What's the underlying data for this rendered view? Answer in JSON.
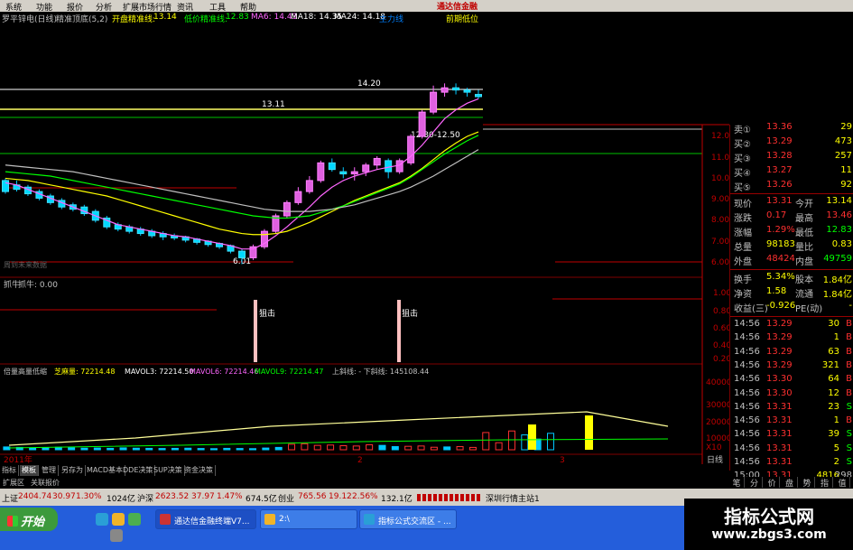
{
  "menu": {
    "items": [
      "系统",
      "功能",
      "报价",
      "分析",
      "扩展市场行情",
      "资讯",
      "工具",
      "帮助"
    ],
    "brand": "通达信金融"
  },
  "info": {
    "title": "罗平锌电(日线)",
    "indicator": "精准顶底(5,2)",
    "open_line_label": "开盘精准线:",
    "open_line_value": "13.14",
    "low_line_label": "低价精准线:",
    "low_line_value": "12.83",
    "ma6": "MA6: 14.43",
    "ma18": "MA18: 14.35",
    "ma24": "MA24: 14.18",
    "tail1": "主力线",
    "tail2": "前期低位"
  },
  "chart": {
    "price_ticks": [
      "12.00",
      "11.00",
      "10.00",
      "9.00",
      "8.00",
      "7.00",
      "6.00"
    ],
    "labels": {
      "high_level": "14.20",
      "mid_level": "13.11",
      "range": "12.30-12.50",
      "low_point": "6.01",
      "dim_note": "周到未来数据"
    },
    "sub1": {
      "title": "抓牛",
      "value": "抓牛: 0.00",
      "ticks": [
        "1.00",
        "0.80",
        "0.60",
        "0.40",
        "0.20"
      ],
      "signal": "狙击"
    },
    "sub2": {
      "title": "倍量高量低缩",
      "vol": "芝麻量: 72214.48",
      "mavol3": "MAVOL3: 72214.50",
      "mavol6": "MAVOL6: 72214.46",
      "mavol9": "MAVOL9: 72214.47",
      "trend": "上斜线: - 下斜线: 145108.44",
      "ticks": [
        "40000",
        "30000",
        "20000",
        "10000"
      ],
      "unit": "X10"
    },
    "x_labels": [
      "2011年",
      "2",
      "3"
    ],
    "period": "日线"
  },
  "quote": {
    "asks": [
      {
        "label": "卖①",
        "price": "13.36",
        "vol": "29"
      },
      {
        "label": "买②",
        "price": "13.29",
        "vol": "473"
      },
      {
        "label": "买③",
        "price": "13.28",
        "vol": "257"
      },
      {
        "label": "买④",
        "price": "13.27",
        "vol": "11"
      },
      {
        "label": "买⑤",
        "price": "13.26",
        "vol": "92"
      }
    ],
    "stats": [
      {
        "k1": "现价",
        "v1": "13.31",
        "k2": "今开",
        "v2": "13.14"
      },
      {
        "k1": "涨跌",
        "v1": "0.17",
        "k2": "最高",
        "v2": "13.46"
      },
      {
        "k1": "涨幅",
        "v1": "1.29%",
        "k2": "最低",
        "v2": "12.83"
      },
      {
        "k1": "总量",
        "v1": "98183",
        "k2": "量比",
        "v2": "0.83"
      },
      {
        "k1": "外盘",
        "v1": "48424",
        "k2": "内盘",
        "v2": "49759"
      }
    ],
    "stats2": [
      {
        "k1": "换手",
        "v1": "5.34%",
        "k2": "股本",
        "v2": "1.84亿"
      },
      {
        "k1": "净资",
        "v1": "1.58",
        "k2": "流通",
        "v2": "1.84亿"
      },
      {
        "k1": "收益(三)",
        "v1": "-0.926",
        "k2": "PE(动)",
        "v2": "-"
      }
    ],
    "ticks": [
      {
        "time": "14:56",
        "price": "13.29",
        "vol": "30",
        "side": "B"
      },
      {
        "time": "14:56",
        "price": "13.29",
        "vol": "1",
        "side": "B"
      },
      {
        "time": "14:56",
        "price": "13.29",
        "vol": "63",
        "side": "B"
      },
      {
        "time": "14:56",
        "price": "13.29",
        "vol": "321",
        "side": "B"
      },
      {
        "time": "14:56",
        "price": "13.30",
        "vol": "64",
        "side": "B"
      },
      {
        "time": "14:56",
        "price": "13.30",
        "vol": "12",
        "side": "B"
      },
      {
        "time": "14:56",
        "price": "13.31",
        "vol": "23",
        "side": "S"
      },
      {
        "time": "14:56",
        "price": "13.31",
        "vol": "1",
        "side": "B"
      },
      {
        "time": "14:56",
        "price": "13.31",
        "vol": "39",
        "side": "S"
      },
      {
        "time": "14:56",
        "price": "13.31",
        "vol": "5",
        "side": "S"
      },
      {
        "time": "14:56",
        "price": "13.31",
        "vol": "2",
        "side": "S"
      },
      {
        "time": "15:00",
        "price": "13.31",
        "vol": "4816",
        "side": "298"
      }
    ],
    "bottom_tabs": [
      "笔",
      "分",
      "价",
      "盘",
      "势",
      "指",
      "值"
    ]
  },
  "tabs": {
    "items": [
      "指标",
      "模板",
      "管理",
      "另存为",
      "MACD基本",
      "DDE决策",
      "SUP决策",
      "资金决策"
    ],
    "active_index": 1,
    "sub_items": [
      "扩展区",
      "关联报价"
    ]
  },
  "status": {
    "sh_label": "上证",
    "sh_value": "2404.74",
    "sh_change": "30.97",
    "sh_pct": "1.30%",
    "sh_amount": "1024亿",
    "sz_label": "沪深",
    "sz_value": "2623.52",
    "sz_change": "37.97",
    "sz_pct": "1.47%",
    "sz_amount": "674.5亿",
    "cy_label": "创业",
    "cy_value": "765.56",
    "cy_change": "19.12",
    "cy_pct": "2.56%",
    "cy_amount": "132.1亿",
    "server": "深圳行情主站1"
  },
  "taskbar": {
    "start": "开始",
    "tasks": [
      "通达信金融终端V7...",
      "2:\\",
      "指标公式交流区 - ..."
    ]
  },
  "watermark": {
    "title": "指标公式网",
    "url": "www.zbgs3.com"
  },
  "chart_data": {
    "type": "candlestick",
    "title": "罗平锌电(日线)",
    "candles": [
      {
        "o": 9.8,
        "c": 9.3,
        "h": 9.9,
        "l": 9.2
      },
      {
        "o": 9.6,
        "c": 9.4,
        "h": 9.8,
        "l": 9.3
      },
      {
        "o": 9.5,
        "c": 9.2,
        "h": 9.6,
        "l": 9.1
      },
      {
        "o": 9.3,
        "c": 9.0,
        "h": 9.4,
        "l": 8.9
      },
      {
        "o": 9.1,
        "c": 8.8,
        "h": 9.2,
        "l": 8.7
      },
      {
        "o": 8.9,
        "c": 8.6,
        "h": 9.0,
        "l": 8.5
      },
      {
        "o": 8.7,
        "c": 8.5,
        "h": 8.8,
        "l": 8.4
      },
      {
        "o": 8.6,
        "c": 8.3,
        "h": 8.7,
        "l": 8.2
      },
      {
        "o": 8.4,
        "c": 8.0,
        "h": 8.5,
        "l": 7.9
      },
      {
        "o": 8.1,
        "c": 7.7,
        "h": 8.2,
        "l": 7.6
      },
      {
        "o": 7.8,
        "c": 7.6,
        "h": 7.9,
        "l": 7.5
      },
      {
        "o": 7.7,
        "c": 7.5,
        "h": 7.8,
        "l": 7.4
      },
      {
        "o": 7.6,
        "c": 7.4,
        "h": 7.7,
        "l": 7.3
      },
      {
        "o": 7.5,
        "c": 7.3,
        "h": 7.6,
        "l": 7.2
      },
      {
        "o": 7.4,
        "c": 7.25,
        "h": 7.5,
        "l": 7.1
      },
      {
        "o": 7.3,
        "c": 7.2,
        "h": 7.4,
        "l": 7.1
      },
      {
        "o": 7.25,
        "c": 7.1,
        "h": 7.3,
        "l": 7.0
      },
      {
        "o": 7.15,
        "c": 7.0,
        "h": 7.2,
        "l": 6.9
      },
      {
        "o": 7.05,
        "c": 6.9,
        "h": 7.1,
        "l": 6.8
      },
      {
        "o": 6.95,
        "c": 6.8,
        "h": 7.0,
        "l": 6.7
      },
      {
        "o": 6.85,
        "c": 6.6,
        "h": 6.9,
        "l": 6.5
      },
      {
        "o": 6.6,
        "c": 6.3,
        "h": 6.7,
        "l": 6.01
      },
      {
        "o": 6.3,
        "c": 6.8,
        "h": 6.9,
        "l": 6.2
      },
      {
        "o": 6.8,
        "c": 7.5,
        "h": 7.6,
        "l": 6.7
      },
      {
        "o": 7.5,
        "c": 8.2,
        "h": 8.3,
        "l": 7.4
      },
      {
        "o": 8.2,
        "c": 8.8,
        "h": 8.9,
        "l": 8.1
      },
      {
        "o": 8.8,
        "c": 9.3,
        "h": 9.5,
        "l": 8.7
      },
      {
        "o": 9.3,
        "c": 9.8,
        "h": 10.0,
        "l": 9.2
      },
      {
        "o": 9.8,
        "c": 10.6,
        "h": 10.7,
        "l": 9.7
      },
      {
        "o": 10.6,
        "c": 10.3,
        "h": 10.8,
        "l": 10.2
      },
      {
        "o": 10.2,
        "c": 10.1,
        "h": 10.4,
        "l": 9.9
      },
      {
        "o": 10.1,
        "c": 10.2,
        "h": 10.4,
        "l": 9.8
      },
      {
        "o": 10.2,
        "c": 10.5,
        "h": 10.6,
        "l": 10.0
      },
      {
        "o": 10.5,
        "c": 10.8,
        "h": 10.9,
        "l": 10.3
      },
      {
        "o": 10.7,
        "c": 10.2,
        "h": 10.8,
        "l": 9.9
      },
      {
        "o": 10.2,
        "c": 10.7,
        "h": 10.8,
        "l": 10.1
      },
      {
        "o": 10.6,
        "c": 11.8,
        "h": 11.9,
        "l": 10.5
      },
      {
        "o": 11.8,
        "c": 12.9,
        "h": 13.0,
        "l": 11.7
      },
      {
        "o": 12.9,
        "c": 13.8,
        "h": 14.1,
        "l": 12.8
      },
      {
        "o": 13.8,
        "c": 14.0,
        "h": 14.2,
        "l": 13.6
      },
      {
        "o": 14.0,
        "c": 13.9,
        "h": 14.2,
        "l": 13.7
      },
      {
        "o": 13.9,
        "c": 13.8,
        "h": 14.0,
        "l": 13.6
      },
      {
        "o": 13.7,
        "c": 13.6,
        "h": 13.9,
        "l": 13.5
      }
    ],
    "ma_series": [
      {
        "color": "#ffffff",
        "values": [
          9.7,
          9.6,
          9.4,
          9.2,
          9.0,
          8.8,
          8.6,
          8.4,
          8.2,
          8.0,
          7.8,
          7.7,
          7.6,
          7.5,
          7.4,
          7.3,
          7.25,
          7.15,
          7.05,
          6.95,
          6.85,
          6.7,
          6.7,
          6.95,
          7.3,
          7.7,
          8.15,
          8.6,
          9.1,
          9.5,
          9.8,
          10.0,
          10.15,
          10.3,
          10.4,
          10.5,
          10.9,
          11.4,
          12.0,
          12.6,
          13.0,
          13.3,
          13.5
        ]
      },
      {
        "color": "#ffff00",
        "values": [
          9.9,
          9.85,
          9.8,
          9.7,
          9.6,
          9.5,
          9.4,
          9.3,
          9.2,
          9.1,
          8.95,
          8.8,
          8.65,
          8.5,
          8.35,
          8.2,
          8.05,
          7.9,
          7.75,
          7.6,
          7.5,
          7.4,
          7.35,
          7.35,
          7.4,
          7.5,
          7.7,
          7.9,
          8.15,
          8.4,
          8.65,
          8.9,
          9.1,
          9.3,
          9.5,
          9.7,
          10.0,
          10.35,
          10.75,
          11.15,
          11.5,
          11.8,
          12.0
        ]
      },
      {
        "color": "#00ff00",
        "values": [
          10.2,
          10.15,
          10.1,
          10.05,
          10.0,
          9.9,
          9.8,
          9.7,
          9.6,
          9.5,
          9.4,
          9.3,
          9.2,
          9.1,
          9.0,
          8.9,
          8.8,
          8.7,
          8.6,
          8.5,
          8.4,
          8.3,
          8.2,
          8.15,
          8.1,
          8.1,
          8.15,
          8.2,
          8.35,
          8.5,
          8.65,
          8.85,
          9.05,
          9.25,
          9.45,
          9.65,
          9.95,
          10.3,
          10.65,
          11.0,
          11.3,
          11.6,
          11.85
        ]
      },
      {
        "color": "#c0c0c0",
        "values": [
          10.5,
          10.45,
          10.4,
          10.35,
          10.3,
          10.25,
          10.2,
          10.1,
          10.0,
          9.9,
          9.8,
          9.7,
          9.6,
          9.5,
          9.4,
          9.3,
          9.2,
          9.1,
          9.0,
          8.9,
          8.8,
          8.7,
          8.6,
          8.5,
          8.45,
          8.4,
          8.4,
          8.4,
          8.45,
          8.5,
          8.6,
          8.7,
          8.85,
          9.0,
          9.15,
          9.3,
          9.5,
          9.75,
          10.0,
          10.3,
          10.6,
          10.9,
          11.2
        ]
      }
    ],
    "ylim": [
      5.5,
      14.5
    ],
    "volumes": [
      1800,
      1500,
      1200,
      1400,
      1600,
      1300,
      1000,
      1100,
      900,
      1200,
      1000,
      900,
      800,
      900,
      1000,
      800,
      700,
      900,
      800,
      700,
      1100,
      1500,
      3500,
      3800,
      2800,
      3000,
      2600,
      2400,
      3200,
      2800,
      2000,
      2200,
      2400,
      1600,
      1800,
      2000,
      1500,
      11000,
      4500,
      12000,
      9500,
      6800,
      10500
    ],
    "volume_ylim": [
      0,
      45000
    ],
    "signals": [
      {
        "index": 22,
        "label": "狙击"
      },
      {
        "index": 36,
        "label": "狙击"
      }
    ]
  }
}
